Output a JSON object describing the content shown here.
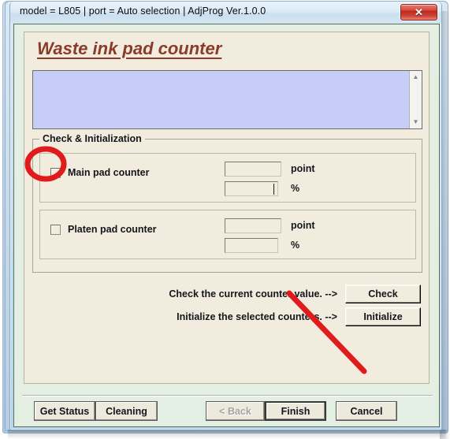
{
  "window": {
    "title": "model = L805 | port = Auto selection | AdjProg Ver.1.0.0",
    "close_label": "✕"
  },
  "page": {
    "heading": "Waste ink pad counter",
    "log_value": "",
    "log_placeholder": ""
  },
  "group": {
    "legend": "Check & Initialization",
    "counters": [
      {
        "label": "Main pad counter",
        "checked": false,
        "point_value": "",
        "point_unit": "point",
        "percent_value": "",
        "percent_unit": "%"
      },
      {
        "label": "Platen pad counter",
        "checked": false,
        "point_value": "",
        "point_unit": "point",
        "percent_value": "",
        "percent_unit": "%"
      }
    ]
  },
  "actions": {
    "check_text": "Check the current counter value. -->",
    "check_button": "Check",
    "initialize_text": "Initialize the selected counters. -->",
    "initialize_button": "Initialize"
  },
  "bottom_bar": {
    "get_status": "Get Status",
    "cleaning": "Cleaning",
    "back": "< Back",
    "finish": "Finish",
    "cancel": "Cancel"
  },
  "annotation": {
    "circle_target": "Main pad counter checkbox",
    "arrow_target": "Initialize button",
    "color": "#e01b1b"
  },
  "colors": {
    "heading": "#8a3b2a",
    "panel": "#f1ecdd",
    "client": "#e3efe2",
    "log_field": "#c6cdf7",
    "close_button": "#c7372a"
  }
}
